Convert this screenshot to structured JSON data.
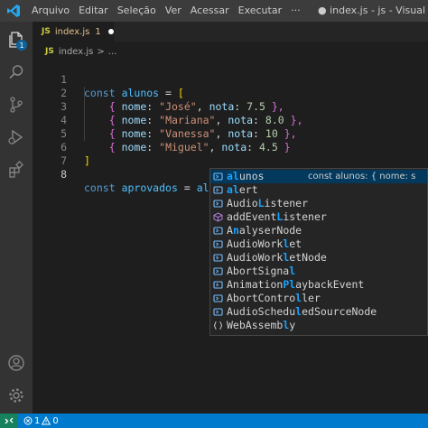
{
  "menu": [
    "Arquivo",
    "Editar",
    "Seleção",
    "Ver",
    "Acessar",
    "Executar",
    "···"
  ],
  "window_title": "● index.js - js - Visual Studio C",
  "activity_bar": {
    "explorer_badge": "1"
  },
  "tab": {
    "icon_text": "JS",
    "name": "index.js",
    "problem_count": "1"
  },
  "breadcrumb": {
    "icon_text": "JS",
    "file": "index.js",
    "sep": ">",
    "rest": "..."
  },
  "line_numbers": [
    "1",
    "2",
    "3",
    "4",
    "5",
    "6",
    "7",
    "8"
  ],
  "code": {
    "l1": {
      "kw": "const",
      "var": "alunos",
      "eq": "=",
      "br": "["
    },
    "rows": [
      {
        "name": "\"José\"",
        "nota": "7.5"
      },
      {
        "name": "\"Mariana\"",
        "nota": "8.0"
      },
      {
        "name": "\"Vanessa\"",
        "nota": "10"
      },
      {
        "name": "\"Miguel\"",
        "nota": "4.5"
      }
    ],
    "row_open": "{",
    "row_close": "},",
    "row_close_last": "}",
    "key_nome": "nome",
    "key_nota": "nota",
    "colon": ":",
    "comma": ",",
    "l6": "]",
    "l8": {
      "kw": "const",
      "var": "aprovados",
      "eq": "=",
      "typed": "al"
    }
  },
  "suggestions": [
    {
      "icon": "variable-icon",
      "pre": "",
      "m1": "al",
      "post": "unos",
      "detail": "const alunos: { nome: s"
    },
    {
      "icon": "variable-icon",
      "pre": "",
      "m1": "al",
      "post": "ert",
      "detail": ""
    },
    {
      "icon": "variable-icon",
      "pre": "Audio",
      "m1": "L",
      "post": "istener",
      "detail": ""
    },
    {
      "icon": "method-icon",
      "pre": "addEvent",
      "m1": "L",
      "post": "istener",
      "detail": ""
    },
    {
      "icon": "variable-icon",
      "pre": "A",
      "m1": "n",
      "post": "alyserNode",
      "detail": ""
    },
    {
      "icon": "variable-icon",
      "pre": "AudioWork",
      "m1": "l",
      "post": "et",
      "detail": ""
    },
    {
      "icon": "variable-icon",
      "pre": "AudioWork",
      "m1": "l",
      "post": "etNode",
      "detail": ""
    },
    {
      "icon": "variable-icon",
      "pre": "AbortSigna",
      "m1": "l",
      "post": "",
      "detail": ""
    },
    {
      "icon": "variable-icon",
      "pre": "Animation",
      "m1": "Pl",
      "post": "aybackEvent",
      "detail": ""
    },
    {
      "icon": "variable-icon",
      "pre": "AbortContro",
      "m1": "l",
      "post": "ler",
      "detail": ""
    },
    {
      "icon": "variable-icon",
      "pre": "AudioSchedu",
      "m1": "l",
      "post": "edSourceNode",
      "detail": ""
    },
    {
      "icon": "module-icon",
      "pre": "WebAssemb",
      "m1": "l",
      "post": "y",
      "detail": ""
    }
  ],
  "status": {
    "errors": "1",
    "warnings": "0"
  },
  "colors": {
    "accent": "#007acc",
    "selection": "#04395e",
    "match": "#18a3ff"
  }
}
